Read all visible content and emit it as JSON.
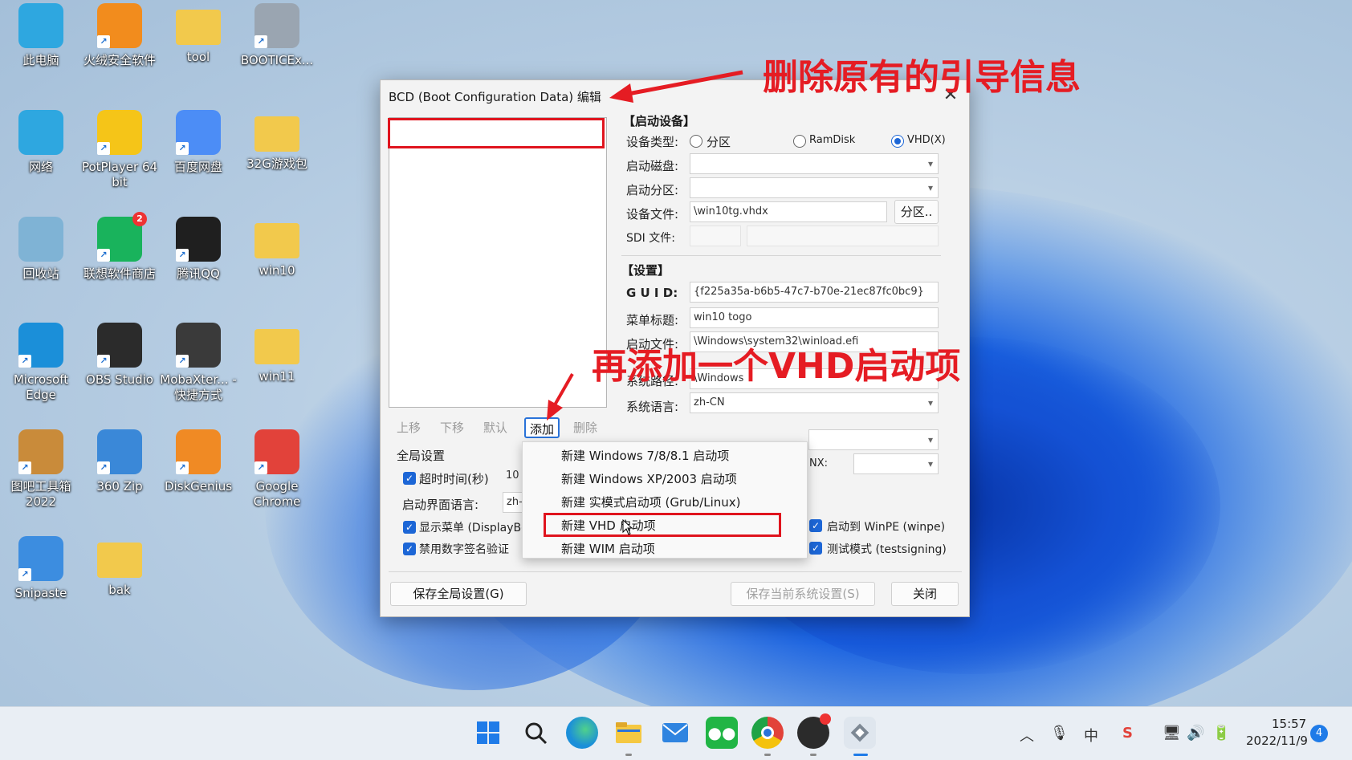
{
  "desktop": {
    "icons": [
      {
        "label": "此电脑",
        "icon": "monitor-icon",
        "color": "#2ea7e0"
      },
      {
        "label": "火绒安全软件",
        "icon": "flame-shield-icon",
        "color": "#f28c1d"
      },
      {
        "label": "tool",
        "icon": "folder-icon",
        "color": "#f2c94c"
      },
      {
        "label": "BOOTICEx...",
        "icon": "bootice-icon",
        "color": "#9aa5b1"
      },
      {
        "label": "网络",
        "icon": "network-globe-icon",
        "color": "#2ea7e0"
      },
      {
        "label": "PotPlayer 64 bit",
        "icon": "potplayer-icon",
        "color": "#f5c518"
      },
      {
        "label": "百度网盘",
        "icon": "baidu-netdisk-icon",
        "color": "#4c8df6"
      },
      {
        "label": "32G游戏包",
        "icon": "folder-icon",
        "color": "#f2c94c"
      },
      {
        "label": "回收站",
        "icon": "recycle-bin-icon",
        "color": "#7fb3d5"
      },
      {
        "label": "联想软件商店",
        "icon": "lenovo-store-icon",
        "color": "#19b35c"
      },
      {
        "label": "腾讯QQ",
        "icon": "qq-penguin-icon",
        "color": "#1f1f1f"
      },
      {
        "label": "win10",
        "icon": "folder-icon",
        "color": "#f2c94c"
      },
      {
        "label": "Microsoft Edge",
        "icon": "edge-icon",
        "color": "#1b8fd9"
      },
      {
        "label": "OBS Studio",
        "icon": "obs-icon",
        "color": "#2b2b2b"
      },
      {
        "label": "MobaXter... - 快捷方式",
        "icon": "mobaxterm-icon",
        "color": "#3a3a3a"
      },
      {
        "label": "win11",
        "icon": "folder-icon",
        "color": "#f2c94c"
      },
      {
        "label": "图吧工具箱 2022",
        "icon": "toolbox-icon",
        "color": "#c98b3a"
      },
      {
        "label": "360 Zip",
        "icon": "zip-archive-icon",
        "color": "#3a88d8"
      },
      {
        "label": "DiskGenius",
        "icon": "diskgenius-icon",
        "color": "#f08a24"
      },
      {
        "label": "Google Chrome",
        "icon": "chrome-icon",
        "color": "#e2423a"
      },
      {
        "label": "Snipaste",
        "icon": "snipaste-icon",
        "color": "#3c8de0"
      },
      {
        "label": "bak",
        "icon": "folder-icon",
        "color": "#f2c94c"
      }
    ],
    "badge_count": "2"
  },
  "dialog": {
    "title": "BCD (Boot Configuration Data) 编辑",
    "list_buttons": {
      "up": "上移",
      "down": "下移",
      "default": "默认",
      "add": "添加",
      "delete": "删除"
    },
    "boot_device": {
      "section": "【启动设备】",
      "device_type_label": "设备类型:",
      "radio_partition": "分区",
      "radio_ramdisk": "RamDisk",
      "radio_vhd": "VHD(X)",
      "boot_disk_label": "启动磁盘:",
      "boot_partition_label": "启动分区:",
      "device_file_label": "设备文件:",
      "device_file_value": "\\win10tg.vhdx",
      "partition_button": "分区..",
      "sdi_file_label": "SDI 文件:"
    },
    "settings": {
      "section": "【设置】",
      "guid_label": "G U I D:",
      "guid_value": "{f225a35a-b6b5-47c7-b70e-21ec87fc0bc9}",
      "menu_title_label": "菜单标题:",
      "menu_title_value": "win10 togo",
      "boot_file_label": "启动文件:",
      "boot_file_value": "\\Windows\\system32\\winload.efi",
      "system_path_label": "系统路径:",
      "system_path_value": "\\Windows",
      "system_lang_label": "系统语言:",
      "system_lang_value": "zh-CN",
      "nx_label": "NX:",
      "boot_winpe": "启动到 WinPE (winpe)",
      "test_mode": "测试模式 (testsigning)"
    },
    "global": {
      "section": "全局设置",
      "timeout_label": "超时时间(秒)",
      "timeout_value": "10",
      "ui_lang_label": "启动界面语言:",
      "ui_lang_value": "zh-",
      "show_menu": "显示菜单 (DisplayBo",
      "disable_sig": "禁用数字签名验证"
    },
    "buttons": {
      "save_global": "保存全局设置(G)",
      "save_current": "保存当前系统设置(S)",
      "close": "关闭"
    }
  },
  "context_menu": {
    "items": [
      "新建 Windows 7/8/8.1 启动项",
      "新建 Windows XP/2003 启动项",
      "新建 实模式启动项 (Grub/Linux)",
      "新建 VHD 启动项",
      "新建 WIM 启动项"
    ]
  },
  "annotations": {
    "delete_note": "删除原有的引导信息",
    "add_note": "再添加一个VHD启动项"
  },
  "taskbar": {
    "time": "15:57",
    "date": "2022/11/9",
    "notification_count": "4",
    "ime": "中"
  },
  "colors": {
    "accent": "#1c66d6",
    "annotation_red": "#e51c23",
    "highlight_red": "#e0141e"
  }
}
